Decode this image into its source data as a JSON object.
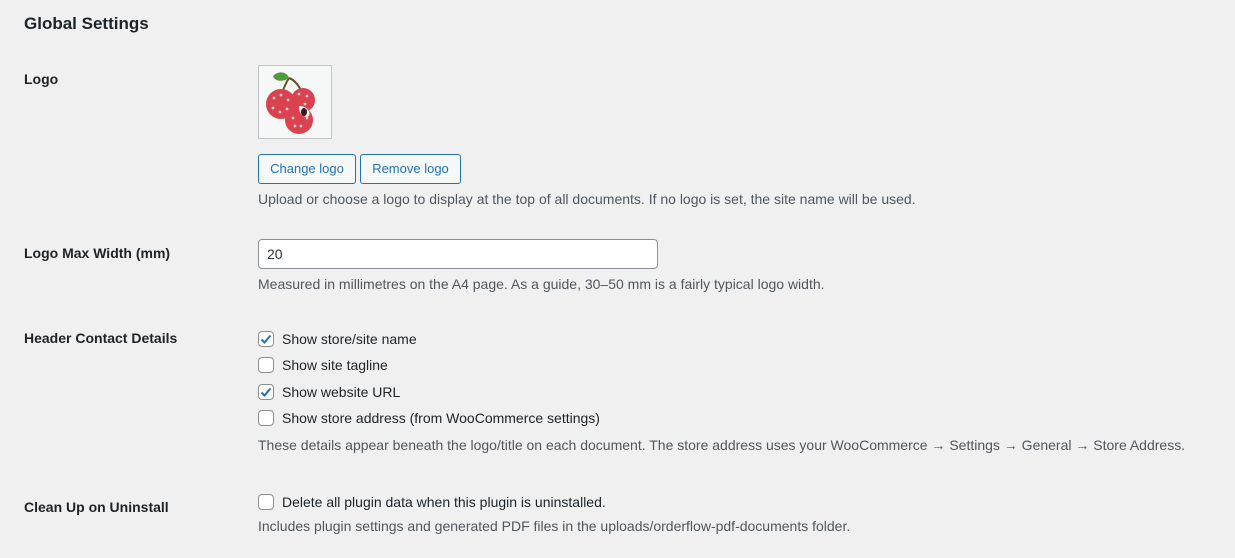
{
  "section_title": "Global Settings",
  "logo": {
    "label": "Logo",
    "image_icon": "lychee-logo",
    "change_button": "Change logo",
    "remove_button": "Remove logo",
    "description": "Upload or choose a logo to display at the top of all documents. If no logo is set, the site name will be used."
  },
  "logo_max_width": {
    "label": "Logo Max Width (mm)",
    "value": "20",
    "description": "Measured in millimetres on the A4 page. As a guide, 30–50 mm is a fairly typical logo width."
  },
  "header_contact": {
    "label": "Header Contact Details",
    "options": [
      {
        "label": "Show store/site name",
        "checked": true
      },
      {
        "label": "Show site tagline",
        "checked": false
      },
      {
        "label": "Show website URL",
        "checked": true
      },
      {
        "label": "Show store address (from WooCommerce settings)",
        "checked": false
      }
    ],
    "description": "These details appear beneath the logo/title on each document. The store address uses your WooCommerce → Settings → General → Store Address."
  },
  "cleanup": {
    "label": "Clean Up on Uninstall",
    "option": {
      "label": "Delete all plugin data when this plugin is uninstalled.",
      "checked": false
    },
    "description": "Includes plugin settings and generated PDF files in the uploads/orderflow-pdf-documents folder."
  },
  "colors": {
    "accent": "#2271b1",
    "text": "#1d2327",
    "muted": "#50575e",
    "background": "#f0f0f1"
  }
}
